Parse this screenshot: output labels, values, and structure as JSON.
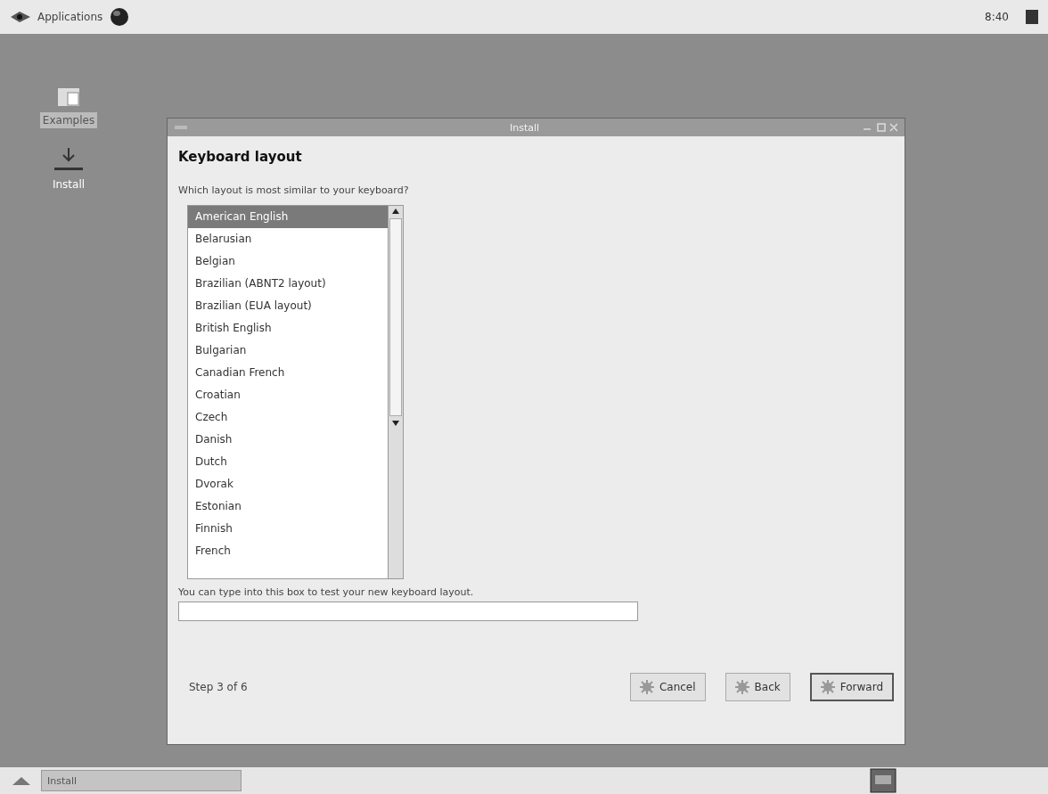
{
  "top_panel": {
    "menu": "Applications",
    "clock": "8:40"
  },
  "desktop_icons": [
    {
      "label": "Examples",
      "selected": true
    },
    {
      "label": "Install",
      "selected": false
    }
  ],
  "window": {
    "title": "Install",
    "heading": "Keyboard layout",
    "prompt": "Which layout is most similar to your keyboard?",
    "layouts": [
      {
        "label": "American English",
        "selected": true
      },
      {
        "label": "Belarusian",
        "selected": false
      },
      {
        "label": "Belgian",
        "selected": false
      },
      {
        "label": "Brazilian (ABNT2 layout)",
        "selected": false
      },
      {
        "label": "Brazilian (EUA layout)",
        "selected": false
      },
      {
        "label": "British English",
        "selected": false
      },
      {
        "label": "Bulgarian",
        "selected": false
      },
      {
        "label": "Canadian French",
        "selected": false
      },
      {
        "label": "Croatian",
        "selected": false
      },
      {
        "label": "Czech",
        "selected": false
      },
      {
        "label": "Danish",
        "selected": false
      },
      {
        "label": "Dutch",
        "selected": false
      },
      {
        "label": "Dvorak",
        "selected": false
      },
      {
        "label": "Estonian",
        "selected": false
      },
      {
        "label": "Finnish",
        "selected": false
      },
      {
        "label": "French",
        "selected": false
      }
    ],
    "test_label": "You can type into this box to test your new keyboard layout.",
    "step": "Step 3 of 6",
    "buttons": [
      {
        "label": "Cancel",
        "default": false
      },
      {
        "label": "Back",
        "default": false
      },
      {
        "label": "Forward",
        "default": true
      }
    ]
  },
  "taskbar": {
    "tasks": [
      {
        "label": "Install",
        "selected": true
      }
    ]
  }
}
